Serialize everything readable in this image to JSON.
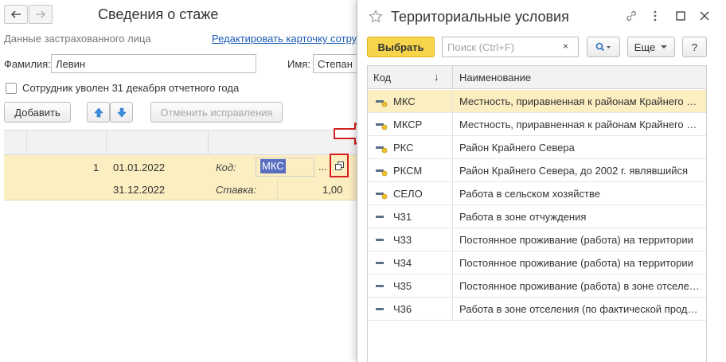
{
  "form": {
    "title": "Сведения о стаже",
    "section_label": "Данные застрахованного лица",
    "edit_link": "Редактировать карточку сотрудника",
    "surname_label": "Фамилия:",
    "surname_value": "Левин",
    "name_label": "Имя:",
    "name_value": "Степан",
    "dismissed_checkbox_label": "Сотрудник уволен 31 декабря отчетного года",
    "add_button": "Добавить",
    "cancel_corrections_button": "Отменить исправления",
    "grid": {
      "row1": {
        "number": "1",
        "date_from": "01.01.2022",
        "code_label": "Код:",
        "code_value": "МКС",
        "dots": "..."
      },
      "row2": {
        "date_to": "31.12.2022",
        "rate_label": "Ставка:",
        "rate_value": "1,00"
      }
    }
  },
  "dialog": {
    "title": "Территориальные условия",
    "select_button": "Выбрать",
    "search_placeholder": "Поиск (Ctrl+F)",
    "search_clear": "×",
    "more_button": "Еще",
    "help_button": "?",
    "col_code": "Код",
    "col_name": "Наименование",
    "sort_indicator": "↓",
    "rows": [
      {
        "code": "МКС",
        "name": "Местность, приравненная к районам Крайнего Севера"
      },
      {
        "code": "МКСР",
        "name": "Местность, приравненная к районам Крайнего Севера"
      },
      {
        "code": "РКС",
        "name": "Район Крайнего Севера"
      },
      {
        "code": "РКСМ",
        "name": "Район Крайнего Севера, до 2002 г. являвшийся"
      },
      {
        "code": "СЕЛО",
        "name": "Работа в сельском хозяйстве"
      },
      {
        "code": "Ч31",
        "name": "Работа в зоне отчуждения"
      },
      {
        "code": "Ч33",
        "name": "Постоянное проживание (работа) на территории"
      },
      {
        "code": "Ч34",
        "name": "Постоянное проживание (работа) на территории"
      },
      {
        "code": "Ч35",
        "name": "Постоянное проживание (работа) в зоне отселения"
      },
      {
        "code": "Ч36",
        "name": "Работа в зоне отселения (по фактической продолжительности)"
      }
    ]
  },
  "icons": {
    "back": "arrow-left-icon",
    "forward": "arrow-right-icon",
    "move_up": "arrow-up-icon",
    "move_down": "arrow-down-icon",
    "open": "open-form-icon",
    "favorite": "star-icon",
    "link": "link-icon",
    "menu": "more-vertical-icon",
    "maximize": "maximize-icon",
    "close": "close-icon",
    "search": "search-icon",
    "row_element": "catalog-element-icon",
    "hint_arrow": "red-arrow-icon"
  },
  "colors": {
    "accent_yellow": "#f6d54a",
    "selection_row": "#fbeec0",
    "highlight_red": "#d42020",
    "link_blue": "#1a5bb5",
    "selected_text_bg": "#5a6fc2"
  }
}
